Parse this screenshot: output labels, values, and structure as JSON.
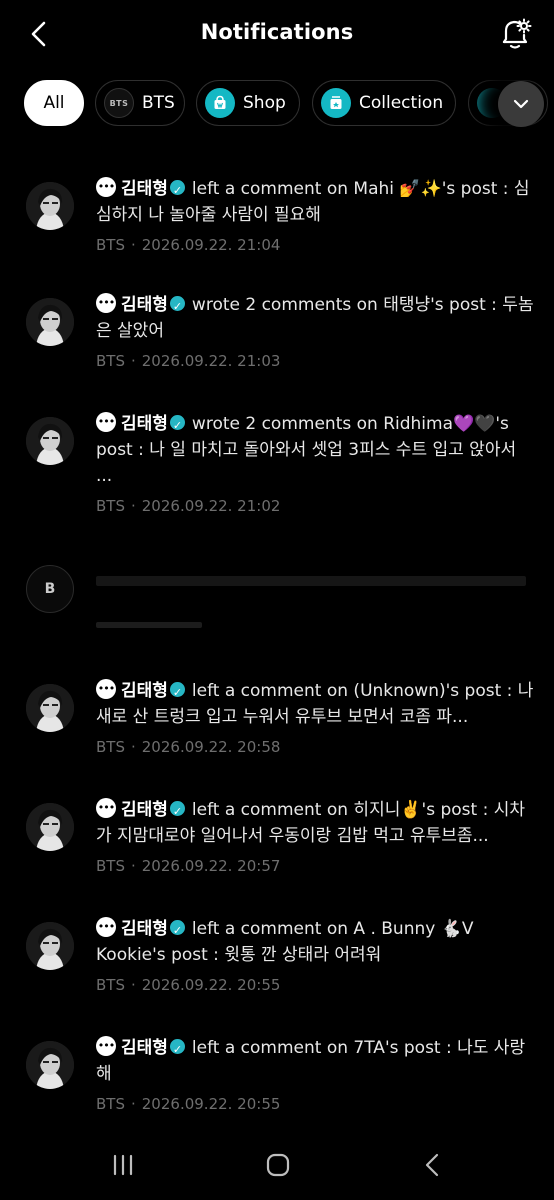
{
  "header": {
    "title": "Notifications",
    "back_icon": "chevron-left-icon",
    "settings_icon": "bell-gear-icon"
  },
  "filters": [
    {
      "label": "All",
      "active": true
    },
    {
      "label": "BTS",
      "icon": "bts-logo-icon",
      "icon_text": "BTS"
    },
    {
      "label": "Shop",
      "icon": "shop-bag-icon"
    },
    {
      "label": "Collection",
      "icon": "collection-icon"
    }
  ],
  "more_icon": "chevron-down-icon",
  "notifications": [
    {
      "user": "김태형",
      "text": "left a comment on Mahi 💅✨'s post : 심심하지 나 놀아줄 사람이 필요해",
      "community": "BTS",
      "time": "2026.09.22. 21:04"
    },
    {
      "user": "김태형",
      "text": "wrote 2 comments on 태탱냥's post : 두놈은 살았어",
      "community": "BTS",
      "time": "2026.09.22. 21:03"
    },
    {
      "user": "김태형",
      "text": "wrote 2 comments on Ridhima💜🖤's post : 나 일 마치고 돌아와서 셋업 3피스 수트 입고 앉아서 ...",
      "community": "BTS",
      "time": "2026.09.22. 21:02"
    },
    {
      "user": "김태형",
      "text": "left a comment on (Unknown)'s post : 나 새로 산 트렁크 입고 누워서 유투브 보면서 코좀 파...",
      "community": "BTS",
      "time": "2026.09.22. 20:58"
    },
    {
      "user": "김태형",
      "text": "left a comment on 히지니✌️'s post : 시차가 지맘대로야 일어나서 우동이랑 김밥 먹고 유투브좀...",
      "community": "BTS",
      "time": "2026.09.22. 20:57"
    },
    {
      "user": "김태형",
      "text": "left a comment on A . Bunny 🐇V Kookie's post : 윗통 깐 상태라 어려워",
      "community": "BTS",
      "time": "2026.09.22. 20:55"
    },
    {
      "user": "김태형",
      "text": "left a comment on 7TA's post : 나도 사랑해",
      "community": "BTS",
      "time": "2026.09.22. 20:55"
    }
  ],
  "redacted_avatar_text": "B",
  "separator": "·",
  "navbar": {
    "recents_icon": "recents-icon",
    "home_icon": "home-icon",
    "back_icon": "back-icon"
  }
}
